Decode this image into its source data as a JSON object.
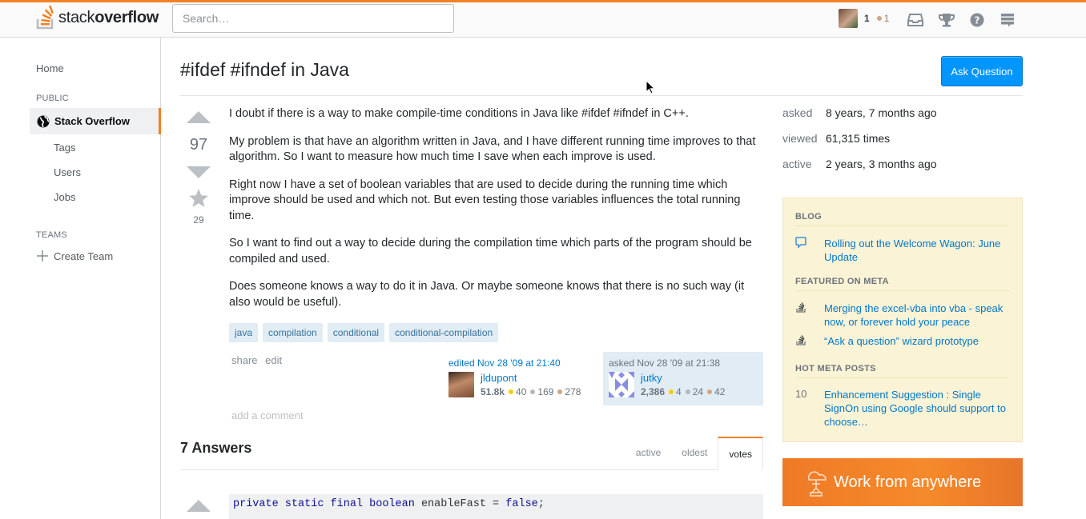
{
  "topbar": {
    "logo_light": "stack",
    "logo_bold": "overflow",
    "search_placeholder": "Search…",
    "reputation": "1",
    "bronze_badges": "1",
    "icons": [
      "inbox-icon",
      "achievements-icon",
      "help-icon",
      "site-switcher-icon"
    ]
  },
  "nav": {
    "home": "Home",
    "public_heading": "PUBLIC",
    "active_item": "Stack Overflow",
    "tags": "Tags",
    "users": "Users",
    "jobs": "Jobs",
    "teams_heading": "TEAMS",
    "create_team": "Create Team"
  },
  "question": {
    "title": "#ifdef #ifndef in Java",
    "ask_button": "Ask Question",
    "votes": "97",
    "favorites": "29",
    "body": [
      "I doubt if there is a way to make compile-time conditions in Java like #ifdef #ifndef in C++.",
      "My problem is that have an algorithm written in Java, and I have different running time improves to that algorithm. So I want to measure how much time I save when each improve is used.",
      "Right now I have a set of boolean variables that are used to decide during the running time which improve should be used and which not. But even testing those variables influences the total running time.",
      "So I want to find out a way to decide during the compilation time which parts of the program should be compiled and used.",
      "Does someone knows a way to do it in Java. Or maybe someone knows that there is no such way (it also would be useful)."
    ],
    "tags": [
      "java",
      "compilation",
      "conditional",
      "conditional-compilation"
    ],
    "share": "share",
    "edit": "edit",
    "editor": {
      "action": "edited Nov 28 '09 at 21:40",
      "name": "jldupont",
      "rep": "51.8k",
      "gold": "40",
      "silver": "169",
      "bronze": "278"
    },
    "owner": {
      "action": "asked Nov 28 '09 at 21:38",
      "name": "jutky",
      "rep": "2,386",
      "gold": "4",
      "silver": "24",
      "bronze": "42"
    },
    "add_comment": "add a comment"
  },
  "answers": {
    "count_label": "7 Answers",
    "tabs": [
      "active",
      "oldest",
      "votes"
    ],
    "active_tab": "votes",
    "code_parts": [
      "private static final boolean",
      " enableFast = ",
      "false",
      ";"
    ]
  },
  "sidebar": {
    "stats": [
      {
        "label": "asked",
        "value": "8 years, 7 months ago"
      },
      {
        "label": "viewed",
        "value": "61,315 times"
      },
      {
        "label": "active",
        "value": "2 years, 3 months ago"
      }
    ],
    "blog_heading": "BLOG",
    "blog_link": "Rolling out the Welcome Wagon: June Update",
    "meta_heading": "FEATURED ON META",
    "meta_links": [
      "Merging the excel-vba into vba - speak now, or forever hold your peace",
      "“Ask a question” wizard prototype"
    ],
    "hot_heading": "HOT META POSTS",
    "hot_count": "10",
    "hot_link": "Enhancement Suggestion : Single SignOn using Google should support to choose…",
    "ad_text": "Work from anywhere"
  }
}
